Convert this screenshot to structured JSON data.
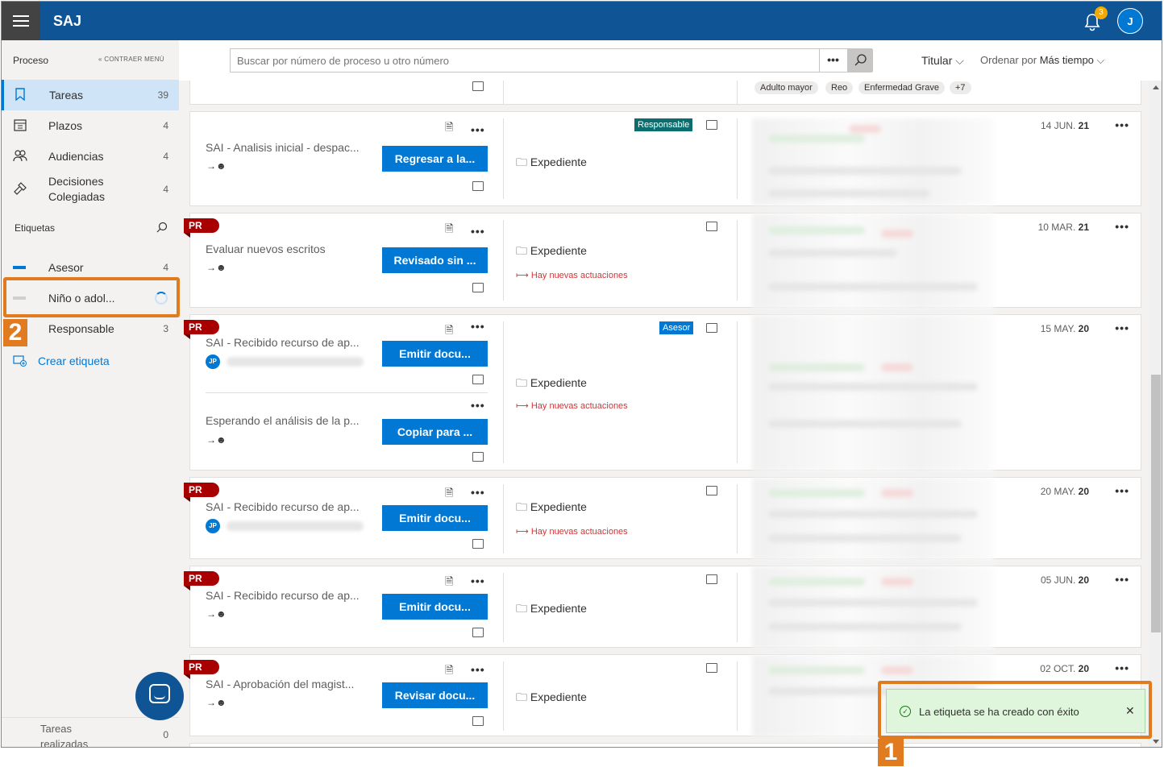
{
  "app": {
    "title": "SAJ",
    "notifications": "3",
    "user_initial": "J"
  },
  "sidebar": {
    "header": "Proceso",
    "collapse": "CONTRAER MENÚ",
    "items": [
      {
        "label": "Tareas",
        "count": "39"
      },
      {
        "label": "Plazos",
        "count": "4"
      },
      {
        "label": "Audiencias",
        "count": "4"
      },
      {
        "label": "Decisiones Colegiadas",
        "count": "4"
      }
    ],
    "tags_header": "Etiquetas",
    "tags": [
      {
        "label": "Asesor",
        "count": "4",
        "color": "#0078d4"
      },
      {
        "label": "Niño o adol...",
        "color": "#d2d0ce"
      },
      {
        "label": "Responsable",
        "count": "3"
      }
    ],
    "create_tag": "Crear etiqueta",
    "done": {
      "label": "Tareas realizadas",
      "count": "0"
    }
  },
  "toolbar": {
    "search_placeholder": "Buscar por número de proceso u otro número",
    "filter": "Titular",
    "order_prefix": "Ordenar por",
    "order_value": "Más tiempo"
  },
  "chips": [
    "Adulto mayor",
    "Reo",
    "Enfermedad Grave",
    "+7"
  ],
  "cards": [
    {
      "title": "SAI - Analisis inicial - despac...",
      "button": "Regresar a la...",
      "expediente": "Expediente",
      "role": "Responsable",
      "date_day": "14 JUN.",
      "date_year": "21"
    },
    {
      "badge": "PR",
      "title": "Evaluar nuevos escritos",
      "button": "Revisado sin ...",
      "expediente": "Expediente",
      "news": "Hay nuevas actuaciones",
      "date_day": "10 MAR.",
      "date_year": "21"
    },
    {
      "badge": "PR",
      "title": "SAI - Recibido recurso de ap...",
      "assignee": "JP",
      "button": "Emitir docu...",
      "subtitle": "Esperando el análisis de la p...",
      "button2": "Copiar para ...",
      "expediente": "Expediente",
      "news": "Hay nuevas actuaciones",
      "role": "Asesor",
      "date_day": "15 MAY.",
      "date_year": "20"
    },
    {
      "badge": "PR",
      "title": "SAI - Recibido recurso de ap...",
      "assignee": "JP",
      "button": "Emitir docu...",
      "expediente": "Expediente",
      "news": "Hay nuevas actuaciones",
      "date_day": "20 MAY.",
      "date_year": "20"
    },
    {
      "badge": "PR",
      "title": "SAI - Recibido recurso de ap...",
      "button": "Emitir docu...",
      "expediente": "Expediente",
      "date_day": "05 JUN.",
      "date_year": "20"
    },
    {
      "badge": "PR",
      "title": "SAI - Aprobación del magist...",
      "button": "Revisar docu...",
      "expediente": "Expediente",
      "date_day": "02 OCT.",
      "date_year": "20"
    }
  ],
  "toast": {
    "message": "La etiqueta se ha creado con éxito",
    "close": "✕"
  },
  "annotations": [
    "1",
    "2"
  ]
}
